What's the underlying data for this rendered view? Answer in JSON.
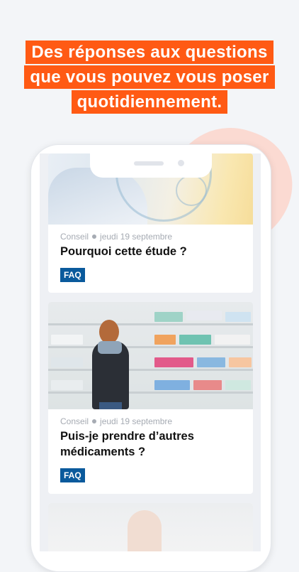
{
  "headline": {
    "line1": "Des réponses aux questions",
    "line2": "que vous pouvez vous poser",
    "line3": "quotidiennement."
  },
  "colors": {
    "accent": "#ff5a14",
    "tag": "#0a5a9c",
    "background": "#f3f5f8"
  },
  "articles": [
    {
      "category": "Conseil",
      "date": "jeudi 19 septembre",
      "title": "Pourquoi cette étude ?",
      "tag": "FAQ"
    },
    {
      "category": "Conseil",
      "date": "jeudi 19 septembre",
      "title": "Puis-je prendre d’autres médicaments ?",
      "tag": "FAQ"
    }
  ]
}
